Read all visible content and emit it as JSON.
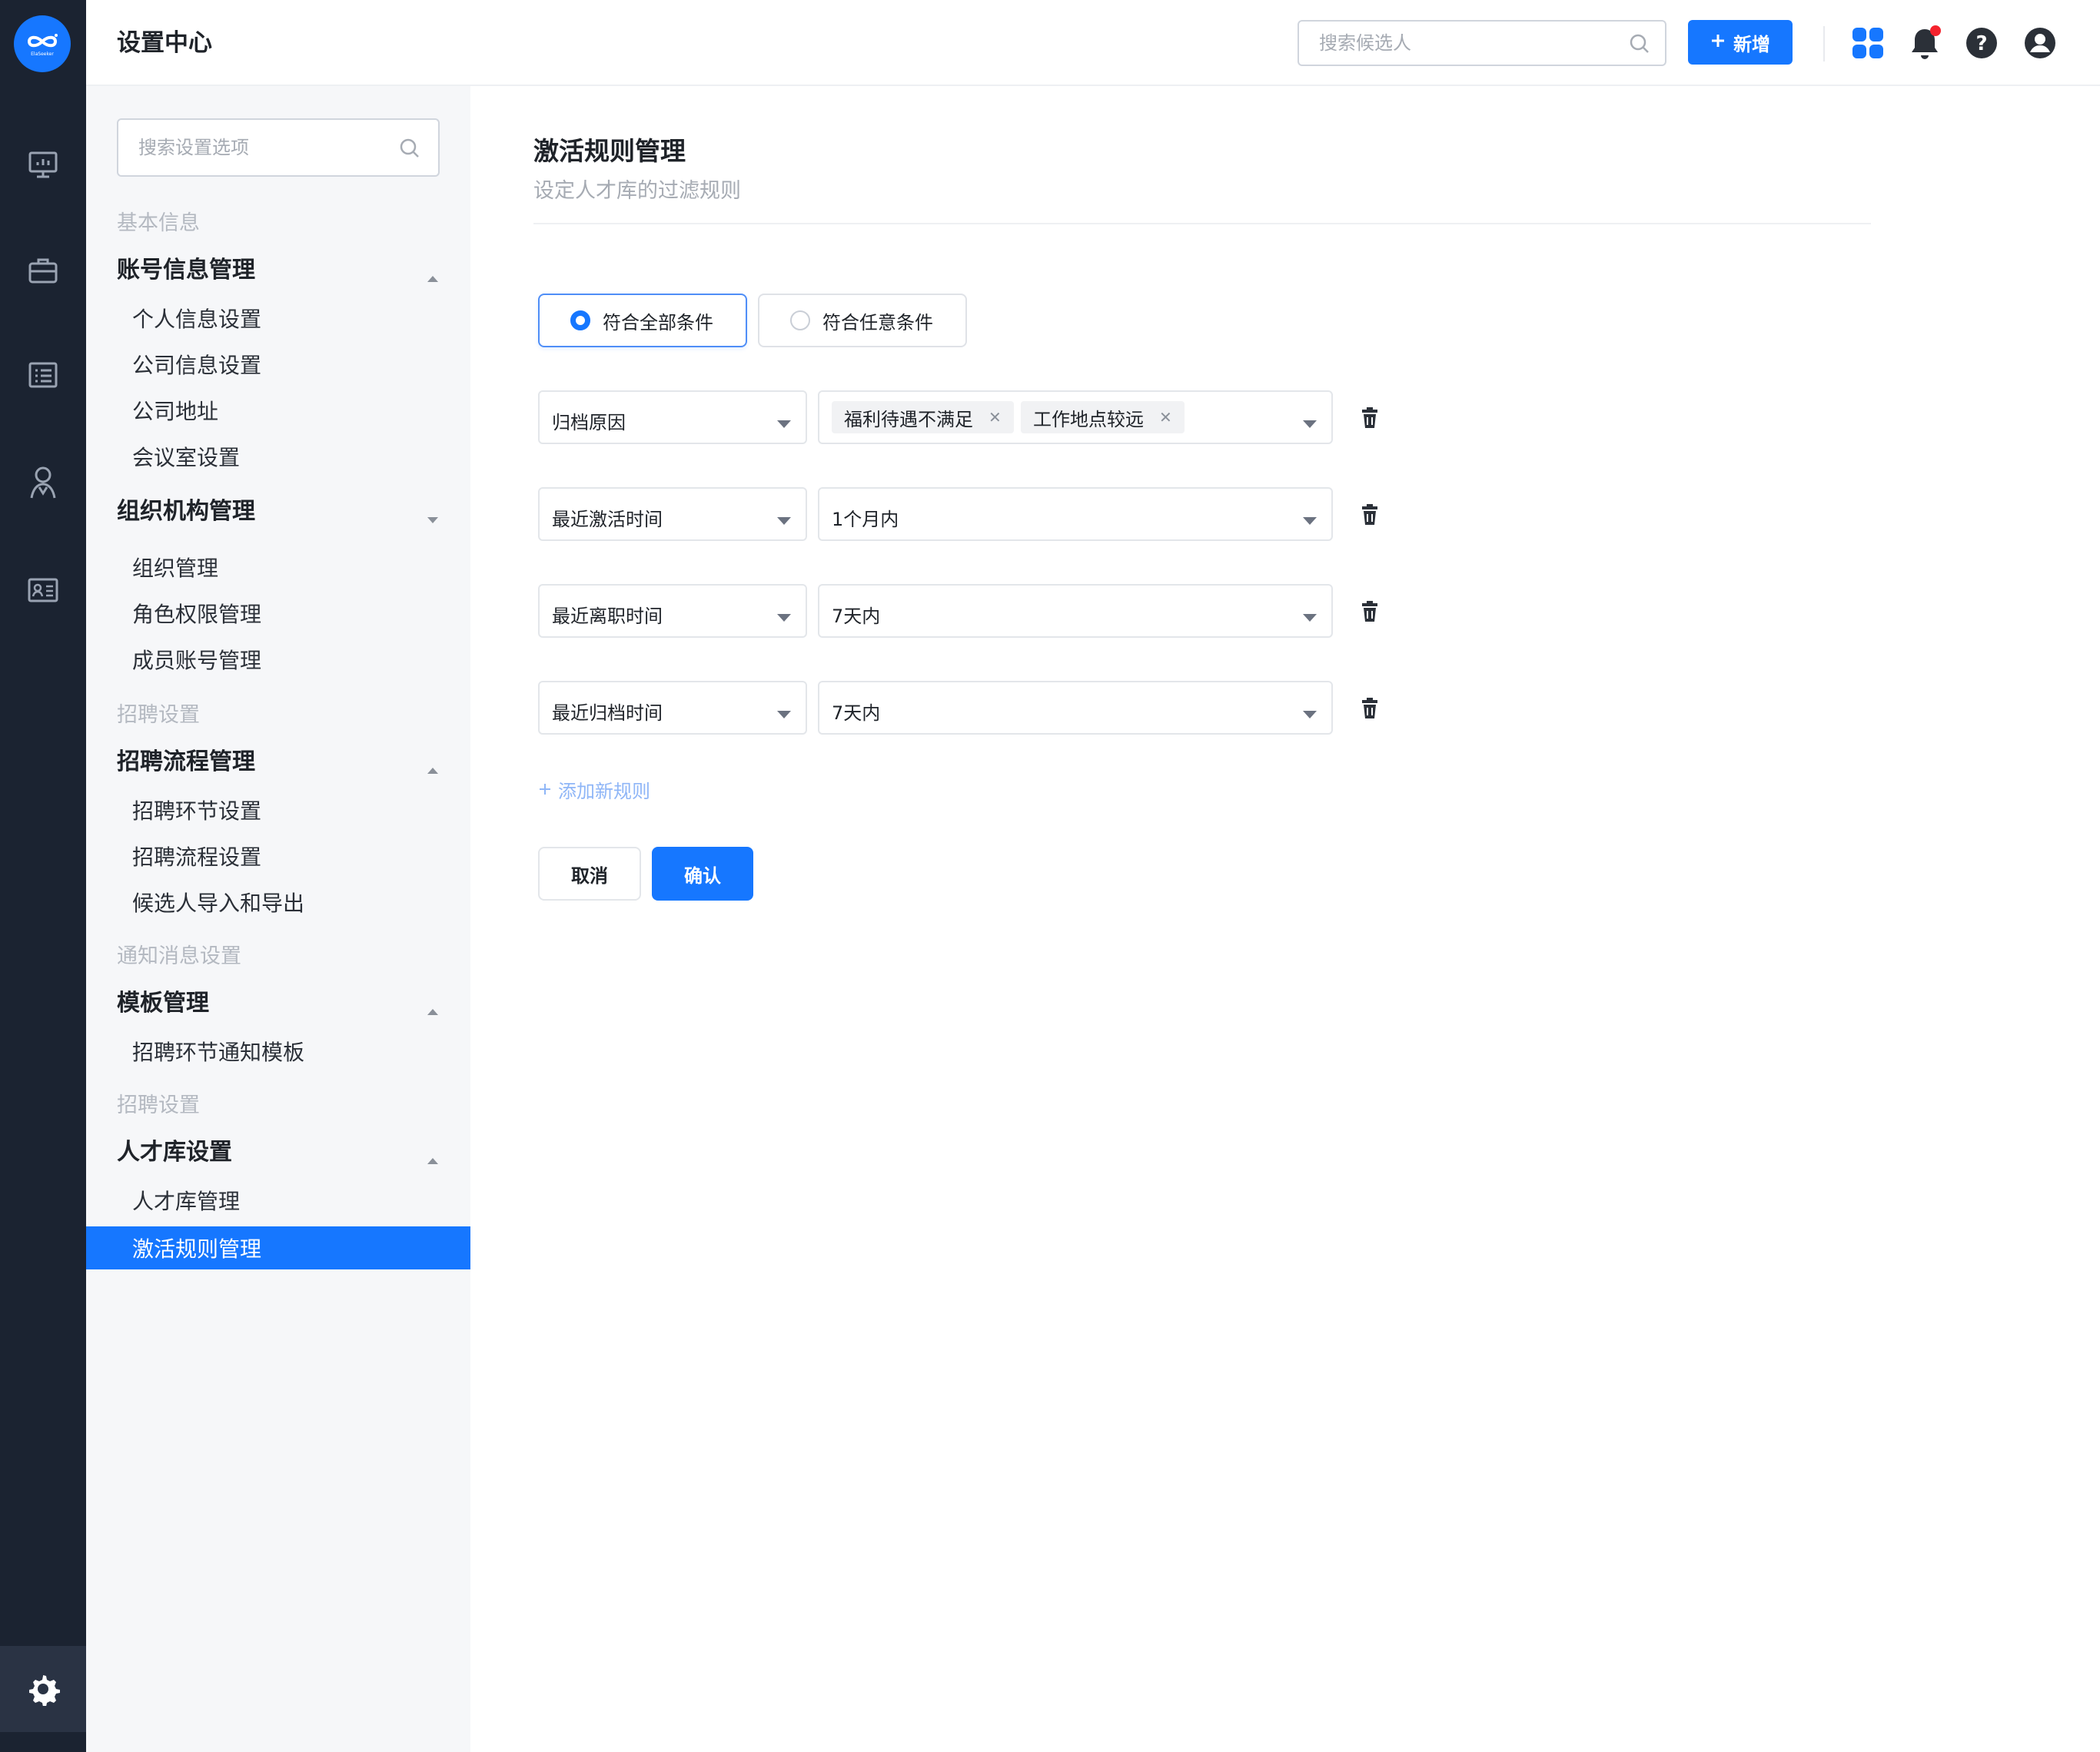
{
  "header": {
    "title": "设置中心",
    "search_placeholder": "搜索候选人",
    "add_label": "新增"
  },
  "rail": {
    "logo_text": "ElaSeeker"
  },
  "menu": {
    "search_placeholder": "搜索设置选项",
    "sections": [
      {
        "label": "基本信息"
      },
      {
        "label": "招聘设置"
      },
      {
        "label": "通知消息设置"
      },
      {
        "label": "招聘设置"
      }
    ],
    "groups": [
      {
        "label": "账号信息管理",
        "expanded": true,
        "items": [
          "个人信息设置",
          "公司信息设置",
          "公司地址",
          "会议室设置"
        ]
      },
      {
        "label": "组织机构管理",
        "expanded": false,
        "items": [
          "组织管理",
          "角色权限管理",
          "成员账号管理"
        ]
      },
      {
        "label": "招聘流程管理",
        "expanded": true,
        "items": [
          "招聘环节设置",
          "招聘流程设置",
          "候选人导入和导出"
        ]
      },
      {
        "label": "模板管理",
        "expanded": true,
        "items": [
          "招聘环节通知模板"
        ]
      },
      {
        "label": "人才库设置",
        "expanded": true,
        "items": [
          "人才库管理",
          "激活规则管理"
        ]
      }
    ],
    "active_item": "激活规则管理"
  },
  "main": {
    "title": "激活规则管理",
    "subtitle": "设定人才库的过滤规则",
    "match_options": [
      {
        "label": "符合全部条件",
        "selected": true
      },
      {
        "label": "符合任意条件",
        "selected": false
      }
    ],
    "rules": [
      {
        "field": "归档原因",
        "tags": [
          "福利待遇不满足",
          "工作地点较远"
        ],
        "value": ""
      },
      {
        "field": "最近激活时间",
        "tags": [],
        "value": "1个月内"
      },
      {
        "field": "最近离职时间",
        "tags": [],
        "value": "7天内"
      },
      {
        "field": "最近归档时间",
        "tags": [],
        "value": "7天内"
      }
    ],
    "add_rule_label": "添加新规则",
    "cancel_label": "取消",
    "confirm_label": "确认"
  },
  "colors": {
    "primary": "#1677ff",
    "rail": "#1b2331",
    "menu_bg": "#f6f7f9",
    "notification_dot": "#f5222d"
  }
}
